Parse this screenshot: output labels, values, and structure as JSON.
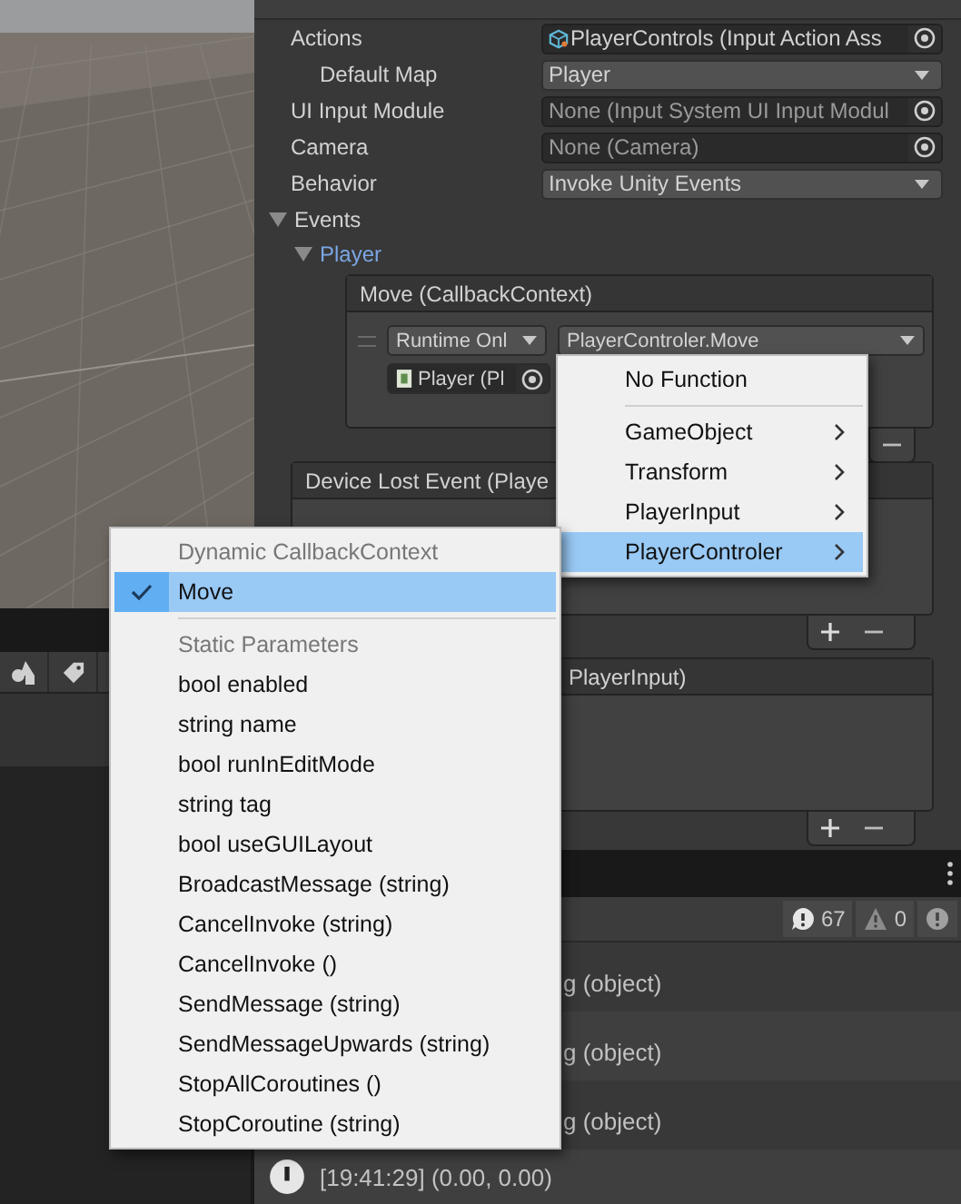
{
  "inspector": {
    "fields": [
      {
        "label": "Actions",
        "kind": "asset",
        "value": "PlayerControls (Input Action Ass",
        "indented": false
      },
      {
        "label": "Default Map",
        "kind": "dropdown",
        "value": "Player",
        "indented": true
      },
      {
        "label": "UI Input Module",
        "kind": "object",
        "value": "None (Input System UI Input Modul",
        "indented": false
      },
      {
        "label": "Camera",
        "kind": "object",
        "value": "None (Camera)",
        "indented": false
      },
      {
        "label": "Behavior",
        "kind": "dropdown",
        "value": "Invoke Unity Events",
        "indented": false
      }
    ],
    "events": {
      "label": "Events",
      "expanded": true,
      "map": {
        "label": "Player",
        "expanded": true
      },
      "move_event": {
        "title": "Move (CallbackContext)",
        "runtime": "Runtime Onl",
        "function": "PlayerControler.Move",
        "target": "Player (Pl"
      },
      "device_lost_event": {
        "title": "Device Lost Event (Playe"
      },
      "device_regained_event": {
        "title": "PlayerInput)"
      }
    }
  },
  "console": {
    "counts": [
      {
        "kind": "log",
        "count": "67"
      },
      {
        "kind": "warning",
        "count": "0"
      },
      {
        "kind": "error"
      }
    ],
    "entries": [
      {
        "text": "g (object)"
      },
      {
        "text": "g (object)"
      },
      {
        "text": "g (object)"
      },
      {
        "text": "[19:41:29] (0.00, 0.00)"
      }
    ]
  },
  "function_menu": {
    "items": [
      {
        "kind": "item",
        "label": "No Function",
        "submenu": false,
        "selected": false
      },
      {
        "kind": "separator"
      },
      {
        "kind": "item",
        "label": "GameObject",
        "submenu": true,
        "selected": false
      },
      {
        "kind": "item",
        "label": "Transform",
        "submenu": true,
        "selected": false
      },
      {
        "kind": "item",
        "label": "PlayerInput",
        "submenu": true,
        "selected": false
      },
      {
        "kind": "item",
        "label": "PlayerControler",
        "submenu": true,
        "selected": true
      }
    ]
  },
  "method_menu": {
    "items": [
      {
        "kind": "header",
        "label": "Dynamic CallbackContext"
      },
      {
        "kind": "item",
        "label": "Move",
        "checked": true,
        "selected": true
      },
      {
        "kind": "separator"
      },
      {
        "kind": "header",
        "label": "Static Parameters"
      },
      {
        "kind": "item",
        "label": "bool enabled",
        "checked": false,
        "selected": false
      },
      {
        "kind": "item",
        "label": "string name",
        "checked": false,
        "selected": false
      },
      {
        "kind": "item",
        "label": "bool runInEditMode",
        "checked": false,
        "selected": false
      },
      {
        "kind": "item",
        "label": "string tag",
        "checked": false,
        "selected": false
      },
      {
        "kind": "item",
        "label": "bool useGUILayout",
        "checked": false,
        "selected": false
      },
      {
        "kind": "item",
        "label": "BroadcastMessage (string)",
        "checked": false,
        "selected": false
      },
      {
        "kind": "item",
        "label": "CancelInvoke (string)",
        "checked": false,
        "selected": false
      },
      {
        "kind": "item",
        "label": "CancelInvoke ()",
        "checked": false,
        "selected": false
      },
      {
        "kind": "item",
        "label": "SendMessage (string)",
        "checked": false,
        "selected": false
      },
      {
        "kind": "item",
        "label": "SendMessageUpwards (string)",
        "checked": false,
        "selected": false
      },
      {
        "kind": "item",
        "label": "StopAllCoroutines ()",
        "checked": false,
        "selected": false
      },
      {
        "kind": "item",
        "label": "StopCoroutine (string)",
        "checked": false,
        "selected": false
      }
    ]
  }
}
